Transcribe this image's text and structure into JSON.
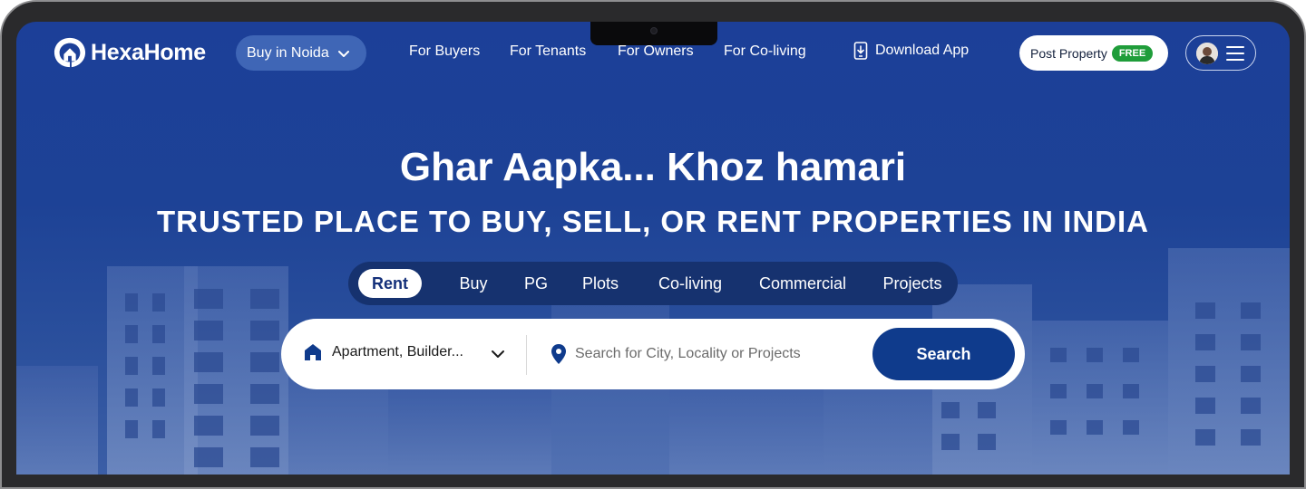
{
  "brand": {
    "name": "HexaHome"
  },
  "nav": {
    "city_selector": "Buy in Noida",
    "links": [
      "For Buyers",
      "For Tenants",
      "For Owners",
      "For Co-living"
    ],
    "download_app": "Download App",
    "post_property": "Post Property",
    "free_badge": "FREE"
  },
  "hero": {
    "title": "Ghar Aapka... Khoz hamari",
    "subtitle": "TRUSTED PLACE TO BUY, SELL, OR RENT PROPERTIES IN INDIA"
  },
  "tabs": {
    "items": [
      "Rent",
      "Buy",
      "PG",
      "Plots",
      "Co-living",
      "Commercial",
      "Projects"
    ],
    "active": "Rent"
  },
  "search": {
    "property_type": "Apartment, Builder...",
    "placeholder": "Search for City, Locality or Projects",
    "button": "Search"
  },
  "colors": {
    "background": "#1c3f98",
    "primary_button": "#0f3b8c",
    "free_badge": "#1f9d3a",
    "city_pill": "#3f66b6"
  },
  "icons": [
    "logo-house-icon",
    "chevron-down-icon",
    "phone-download-icon",
    "avatar",
    "hamburger-menu-icon",
    "home-icon",
    "location-pin-icon"
  ]
}
